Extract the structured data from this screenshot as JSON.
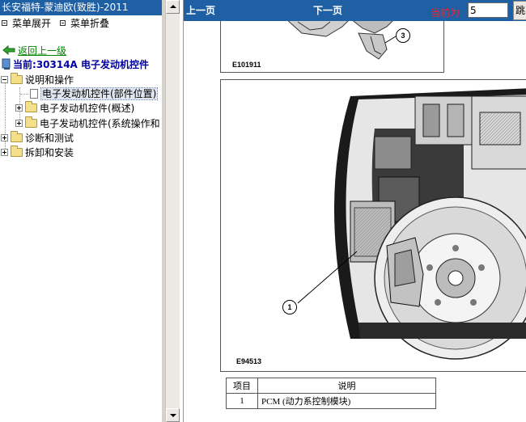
{
  "window": {
    "title": "长安福特-蒙迪欧(致胜)-2011"
  },
  "left_menu": {
    "expand_label": "菜单展开",
    "collapse_label": "菜单折叠",
    "back_label": "返回上一级",
    "current_prefix": "当前:",
    "current_value": "30314A 电子发动机控件"
  },
  "tree": {
    "items": [
      {
        "label": "说明和操作",
        "state": "expanded"
      },
      {
        "label": "电子发动机控件(部件位置)",
        "state": "selected-document"
      },
      {
        "label": "电子发动机控件(概述)",
        "state": "collapsed"
      },
      {
        "label": "电子发动机控件(系统操作和",
        "state": "collapsed"
      },
      {
        "label": "诊断和测试",
        "state": "collapsed"
      },
      {
        "label": "拆卸和安装",
        "state": "collapsed"
      }
    ]
  },
  "nav": {
    "prev_label": "上一页",
    "next_label": "下一页",
    "current_page_label": "当前为",
    "current_page_value": "5",
    "go_label": "跳"
  },
  "figures": [
    {
      "code": "E101911",
      "callout": "3"
    },
    {
      "code": "E94513",
      "callout": "1"
    }
  ],
  "legend": {
    "headers": [
      "项目",
      "说明"
    ],
    "rows": [
      {
        "item": "1",
        "desc": "PCM (动力系控制模块)"
      }
    ]
  },
  "colors": {
    "title_bar": "#1f5fa3",
    "current_label": "#ff2020",
    "back_link": "#008000",
    "current_item_text": "#0000a0"
  }
}
